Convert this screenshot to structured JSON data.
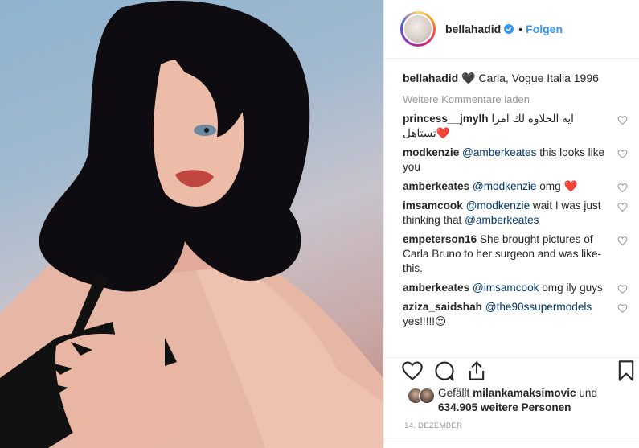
{
  "header": {
    "username": "bellahadid",
    "separator": "•",
    "follow_label": "Folgen"
  },
  "caption": {
    "user": "bellahadid",
    "emoji": "🖤",
    "text": "Carla, Vogue Italia 1996"
  },
  "load_more": "Weitere Kommentare laden",
  "comments": [
    {
      "user": "princess__jmylh",
      "parts": [
        "ايه الحلاوه لك امرا تستاهل❤️"
      ]
    },
    {
      "user": "modkenzie",
      "mention": "@amberkeates",
      "text": "this looks like you"
    },
    {
      "user": "amberkeates",
      "mention": "@modkenzie",
      "text": "omg ❤️"
    },
    {
      "user": "imsamcook",
      "mention": "@modkenzie",
      "text": "wait I was just thinking that",
      "mention2": "@amberkeates"
    },
    {
      "user": "empeterson16",
      "text": "She brought pictures of Carla Bruno to her surgeon and was like- this."
    },
    {
      "user": "amberkeates",
      "mention": "@imsamcook",
      "text": "omg ily guys"
    },
    {
      "user": "aziza_saidshah",
      "mention": "@the90ssupermodels",
      "text": "yes!!!!!😍"
    }
  ],
  "likes": {
    "prefix": "Gefällt",
    "user": "milankamaksimovic",
    "middle": "und",
    "count": "634.905 weitere Personen"
  },
  "date": "14. DEZEMBER",
  "icons": [
    "like-icon",
    "comment-icon",
    "share-icon",
    "bookmark-icon",
    "verified-badge-icon",
    "heart-icon"
  ],
  "colors": {
    "link": "#3897f0",
    "mention": "#003569",
    "muted": "#999999",
    "verified": "#3897f0"
  }
}
